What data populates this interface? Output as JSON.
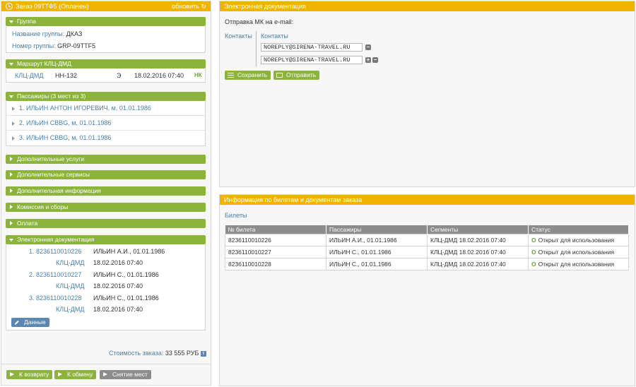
{
  "order": {
    "title": "Заказ 09ТТФ5 (Оплачен)",
    "refresh_label": "обновить",
    "group": {
      "header": "Группа",
      "name_label": "Название группы:",
      "name_value": "ДКАЗ",
      "number_label": "Номер группы:",
      "number_value": "GRP-09TTF5"
    },
    "route": {
      "header": "Маршрут КЛЦ-ДМД",
      "segment": "КЛЦ-ДМД",
      "flight": "НН-132",
      "class": "Э",
      "datetime": "18.02.2016 07:40",
      "status": "НК"
    },
    "passengers": {
      "header": "Пассажиры (3 мест из 3)",
      "items": [
        "1. ИЛЬИН АНТОН ИГОРЕВИЧ, м, 01.01.1986",
        "2. ИЛЬИН СВВG, м, 01.01.1986",
        "3. ИЛЬИН СВВG, м, 01.01.1986"
      ]
    },
    "collapsed_sections": [
      "Дополнительные услуги",
      "Дополнительные сервисы",
      "Дополнительная информация",
      "Комиссия и сборы",
      "Оплата"
    ],
    "edoc": {
      "header": "Электронная документация",
      "items": [
        {
          "ticket": "1. 8236110010226",
          "passenger": "ИЛЬИН А.И., 01.01.1986",
          "segment": "КЛЦ-ДМД",
          "datetime": "18.02.2016 07:40"
        },
        {
          "ticket": "2. 8236110010227",
          "passenger": "ИЛЬИН С., 01.01.1986",
          "segment": "КЛЦ-ДМД",
          "datetime": "18.02.2016 07:40"
        },
        {
          "ticket": "3. 8236110010228",
          "passenger": "ИЛЬИН С., 01.01.1986",
          "segment": "КЛЦ-ДМД",
          "datetime": "18.02.2016 07:40"
        }
      ],
      "data_button": "Данные"
    },
    "cost_label": "Стоимость заказа:",
    "cost_value": "33 555 РУБ",
    "buttons": {
      "refund": "К возврату",
      "exchange": "К обмену",
      "cancel_seats": "Снятие мест"
    }
  },
  "edoc_panel": {
    "title": "Электронная документация",
    "send_label": "Отправка МК на e-mail:",
    "contacts_side_label": "Контакты",
    "contacts_header": "Контакты",
    "emails": [
      "NOREPLY@SIRENA-TRAVEL.RU",
      "NOREPLY@SIRENA-TRAVEL.RU"
    ],
    "save_button": "Сохранить",
    "send_button": "Отправить"
  },
  "info_panel": {
    "title": "Информация по билетам и документам заказа",
    "subtitle": "Билеты",
    "columns": [
      "№ билета",
      "Пассажиры",
      "Сегменты",
      "Статус"
    ],
    "rows": [
      {
        "ticket": "8236110010226",
        "passenger": "ИЛЬИН А.И., 01.01.1986",
        "segment": "КЛЦ-ДМД  18.02.2016 07:40",
        "status_mark": "О",
        "status": "Открыт для использования"
      },
      {
        "ticket": "8236110010227",
        "passenger": "ИЛЬИН С., 01.01.1986",
        "segment": "КЛЦ-ДМД  18.02.2016 07:40",
        "status_mark": "О",
        "status": "Открыт для использования"
      },
      {
        "ticket": "8236110010228",
        "passenger": "ИЛЬИН С., 01.01.1986",
        "segment": "КЛЦ-ДМД  18.02.2016 07:40",
        "status_mark": "О",
        "status": "Открыт для использования"
      }
    ]
  },
  "colors": {
    "header_yellow": "#f0b400",
    "section_green": "#8cb43c",
    "link_blue": "#4a7fa6",
    "button_gray": "#8c8c8c"
  }
}
